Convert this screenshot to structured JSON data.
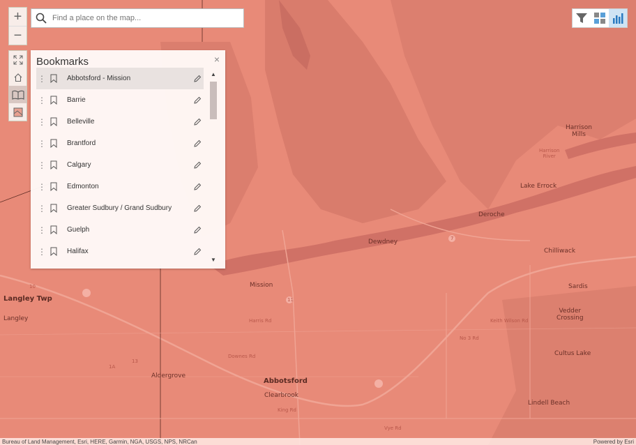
{
  "search": {
    "placeholder": "Find a place on the map..."
  },
  "zoom": {
    "in_label": "+",
    "out_label": "−"
  },
  "bookmarks": {
    "title": "Bookmarks",
    "close_label": "×",
    "items": [
      {
        "label": "Abbotsford - Mission"
      },
      {
        "label": "Barrie"
      },
      {
        "label": "Belleville"
      },
      {
        "label": "Brantford"
      },
      {
        "label": "Calgary"
      },
      {
        "label": "Edmonton"
      },
      {
        "label": "Greater Sudbury / Grand Sudbury"
      },
      {
        "label": "Guelph"
      },
      {
        "label": "Halifax"
      }
    ]
  },
  "map_labels": {
    "harrison_mills": "Harrison\nMills",
    "harrison_river": "Harrison\nRiver",
    "lake_errock": "Lake Errock",
    "deroche": "Deroche",
    "dewdney": "Dewdney",
    "chilliwack": "Chilliwack",
    "mission": "Mission",
    "sardis": "Sardis",
    "vedder_crossing": "Vedder\nCrossing",
    "langley_twp": "Langley Twp",
    "langley": "Langley",
    "aldergrove": "Aldergrove",
    "abbotsford": "Abbotsford",
    "clearbrook": "Clearbrook",
    "cultus_lake": "Cultus Lake",
    "lindell_beach": "Lindell Beach",
    "king_rd": "King Rd",
    "vye_rd": "Vye Rd",
    "harris_rd": "Harris Rd",
    "downes_rd": "Downes Rd",
    "no3_rd": "No 3 Rd",
    "keith_wilson_rd": "Keith Wilson Rd",
    "hwy_11": "11",
    "hwy_1a": "1A",
    "hwy_13": "13",
    "hwy_7": "7",
    "hwy_10": "10"
  },
  "attribution": {
    "left": "Bureau of Land Management, Esri, HERE, Garmin, NGA, USGS, NPS, NRCan",
    "right": "Powered by Esri"
  },
  "colors": {
    "map_base": "#e88a78",
    "water": "#d98474",
    "terrain_dark": "#d47a6a",
    "road": "#f0a090"
  },
  "icons": {
    "search": "search-icon",
    "expand": "expand-icon",
    "home": "home-icon",
    "bookmarks": "book-icon",
    "basemap": "basemap-icon",
    "filter": "filter-icon",
    "layers": "layer-list-icon",
    "chart": "chart-icon"
  }
}
